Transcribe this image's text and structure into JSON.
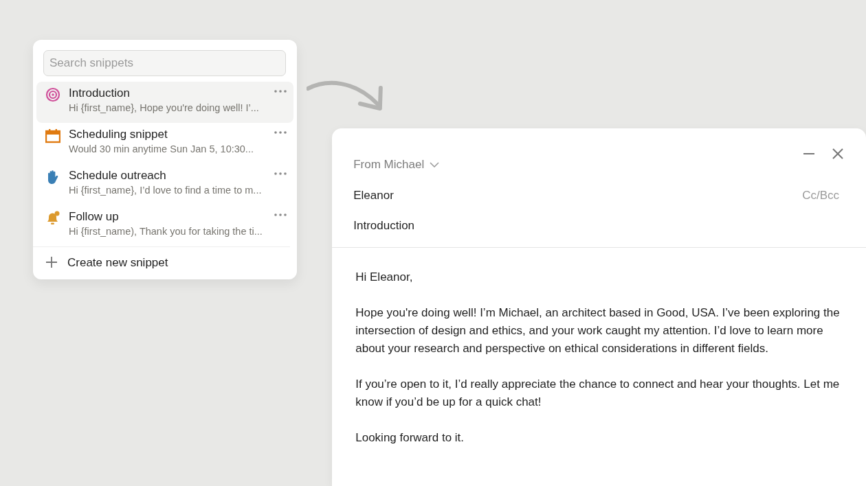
{
  "snippet_panel": {
    "search": {
      "placeholder": "Search snippets"
    },
    "snippets": [
      {
        "kind": "target",
        "color": "#d0509a",
        "title": "Introduction",
        "preview": "Hi {first_name},  Hope you're doing well! I’...",
        "selected": true
      },
      {
        "kind": "calendar",
        "color": "#e07a10",
        "title": "Scheduling snippet",
        "preview": "Would 30 min anytime Sun Jan 5, 10:30...",
        "selected": false
      },
      {
        "kind": "hand",
        "color": "#3a7fb5",
        "title": "Schedule outreach",
        "preview": "Hi {first_name}, I’d love to find a time to m...",
        "selected": false
      },
      {
        "kind": "bell",
        "color": "#dc9a2e",
        "title": "Follow up",
        "preview": "Hi {first_name), Thank you for taking the ti...",
        "selected": false
      }
    ],
    "create_label": "Create new snippet"
  },
  "email": {
    "from": "From Michael",
    "to": "Eleanor",
    "cc_bcc": "Cc/Bcc",
    "subject": "Introduction",
    "body": [
      "Hi Eleanor,",
      "Hope you're doing well! I’m Michael, an architect based in Good, USA. I’ve been exploring the intersection of design and ethics, and your work caught my attention. I’d love to learn more about your research and perspective on ethical considerations in different fields.",
      "If you’re open to it, I’d really appreciate the chance to connect and hear your thoughts. Let me know if you’d be up for a quick chat!",
      "Looking forward to it."
    ]
  }
}
